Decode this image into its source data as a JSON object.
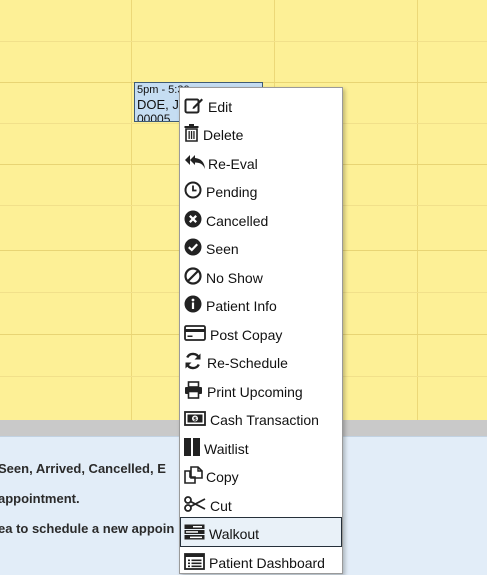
{
  "appointment": {
    "time": "5pm - 5:30",
    "patient": "DOE, J",
    "id": "00005"
  },
  "info": {
    "line1": "Seen, Arrived, Cancelled, E",
    "line2": "appointment.",
    "line3": "ea to schedule a new appoin"
  },
  "menu": {
    "items": [
      {
        "label": "Edit",
        "icon": "edit-icon"
      },
      {
        "label": "Delete",
        "icon": "trash-icon"
      },
      {
        "label": "Re-Eval",
        "icon": "reply-all-icon"
      },
      {
        "label": "Pending",
        "icon": "clock-icon"
      },
      {
        "label": "Cancelled",
        "icon": "x-circle-icon"
      },
      {
        "label": "Seen",
        "icon": "check-circle-icon"
      },
      {
        "label": "No Show",
        "icon": "ban-icon"
      },
      {
        "label": "Patient Info",
        "icon": "info-circle-icon"
      },
      {
        "label": "Post Copay",
        "icon": "credit-card-icon"
      },
      {
        "label": "Re-Schedule",
        "icon": "refresh-icon"
      },
      {
        "label": "Print Upcoming",
        "icon": "printer-icon"
      },
      {
        "label": "Cash Transaction",
        "icon": "money-icon"
      },
      {
        "label": "Waitlist",
        "icon": "columns-icon"
      },
      {
        "label": "Copy",
        "icon": "copy-icon"
      },
      {
        "label": "Cut",
        "icon": "scissors-icon"
      },
      {
        "label": "Walkout",
        "icon": "tasks-icon"
      },
      {
        "label": "Patient Dashboard",
        "icon": "list-alt-icon"
      }
    ],
    "highlighted": "Walkout"
  }
}
